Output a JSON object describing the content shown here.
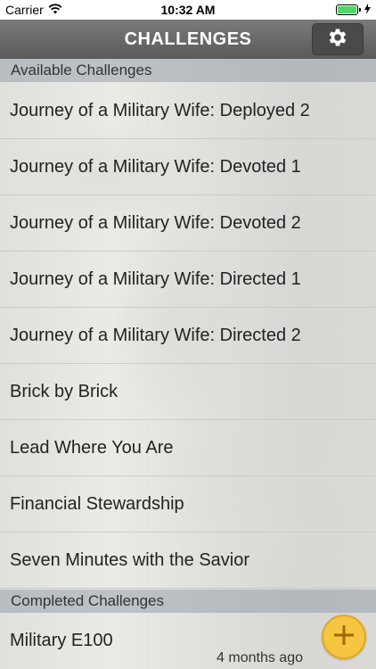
{
  "status_bar": {
    "carrier": "Carrier",
    "time": "10:32 AM",
    "wifi_icon": "wifi-icon",
    "battery_icon": "battery-icon",
    "charging_icon": "charging-icon"
  },
  "nav": {
    "title": "CHALLENGES",
    "settings_icon": "gear-icon"
  },
  "sections": {
    "available_header": "Available Challenges",
    "completed_header": "Completed Challenges"
  },
  "available_challenges": [
    {
      "label": "Journey of a Military Wife: Deployed 2"
    },
    {
      "label": "Journey of a Military Wife: Devoted 1"
    },
    {
      "label": "Journey of a Military Wife: Devoted 2"
    },
    {
      "label": "Journey of a Military Wife: Directed 1"
    },
    {
      "label": "Journey of a Military Wife: Directed 2"
    },
    {
      "label": "Brick by Brick"
    },
    {
      "label": "Lead Where You Are"
    },
    {
      "label": "Financial Stewardship"
    },
    {
      "label": "Seven Minutes with the Savior"
    }
  ],
  "completed_challenges": [
    {
      "label": "Military E100",
      "time": "4 months ago"
    }
  ],
  "fab": {
    "icon": "plus-icon"
  },
  "colors": {
    "nav_bg": "#5f5f5f",
    "fab_bg": "#f6c542",
    "battery_fill": "#4cd964"
  }
}
